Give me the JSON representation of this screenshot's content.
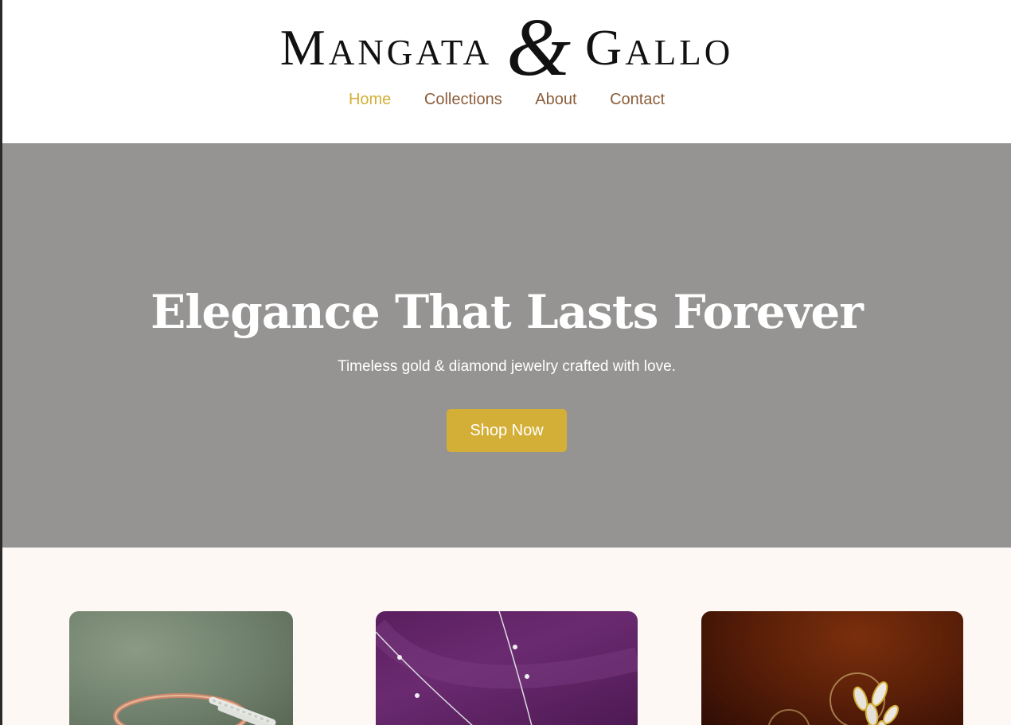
{
  "brand": {
    "name_left": "Mangata",
    "ampersand": "&",
    "name_right": "Gallo"
  },
  "nav": {
    "items": [
      {
        "label": "Home",
        "active": true
      },
      {
        "label": "Collections",
        "active": false
      },
      {
        "label": "About",
        "active": false
      },
      {
        "label": "Contact",
        "active": false
      }
    ]
  },
  "hero": {
    "title": "Elegance That Lasts Forever",
    "subtitle": "Timeless gold & diamond jewelry crafted with love.",
    "cta_label": "Shop Now"
  },
  "products": [
    {
      "subject": "rose-gold-diamond-ring"
    },
    {
      "subject": "silver-station-chain-necklace"
    },
    {
      "subject": "gold-marquise-cluster-earrings"
    }
  ],
  "colors": {
    "accent_gold": "#d4af37",
    "nav_brown": "#8b5e3c",
    "hero_bg": "#959493",
    "section_bg": "#fdf8f4"
  }
}
